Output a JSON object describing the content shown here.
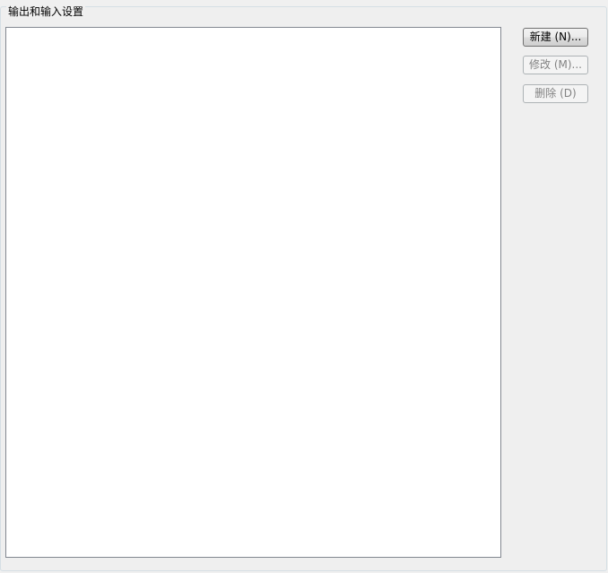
{
  "group": {
    "title": "输出和输入设置"
  },
  "list": {
    "items": []
  },
  "buttons": {
    "new_label": "新建 (N)...",
    "edit_label": "修改 (M)...",
    "delete_label": "删除 (D)"
  }
}
